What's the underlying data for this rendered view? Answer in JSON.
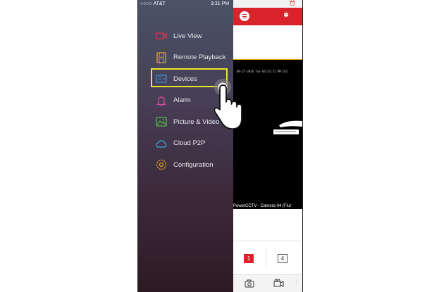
{
  "status_bar": {
    "carrier": "○○○○ AT&T",
    "time": "3:31 PM",
    "right": "⏰ ▮"
  },
  "menu": {
    "items": [
      {
        "label": "Live View",
        "icon": "camera-icon",
        "color": "#e0344a"
      },
      {
        "label": "Remote Playback",
        "icon": "film-icon",
        "color": "#e8a030"
      },
      {
        "label": "Devices",
        "icon": "device-icon",
        "color": "#3b8fd8"
      },
      {
        "label": "Alarm",
        "icon": "bell-icon",
        "color": "#d84aa0"
      },
      {
        "label": "Picture & Video",
        "icon": "picture-icon",
        "color": "#55b84a"
      },
      {
        "label": "Cloud P2P",
        "icon": "cloud-icon",
        "color": "#39a8e0"
      },
      {
        "label": "Configuration",
        "icon": "gear-icon",
        "color": "#e0a020"
      }
    ]
  },
  "video": {
    "osd_text": "09-27-2016 Tue 03:31:11 PM CEI",
    "camera_label": "PowerCCTV - Camera 04 (Flur"
  },
  "layout_buttons": {
    "single": "1",
    "quad": "4"
  },
  "colors": {
    "accent_red": "#d8232a",
    "highlight_yellow": "#e8e62a"
  }
}
